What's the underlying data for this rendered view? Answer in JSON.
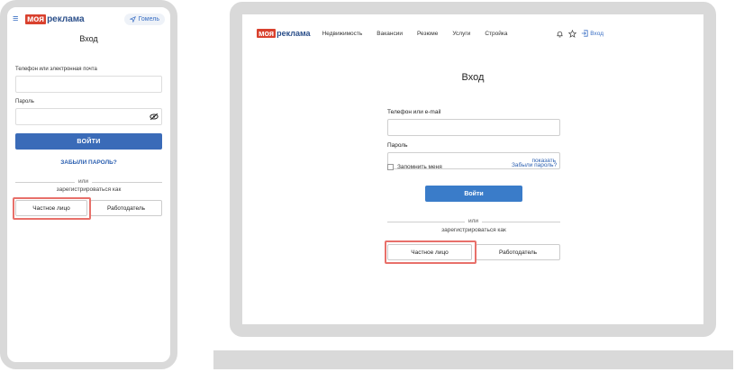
{
  "brand": {
    "box": "моя",
    "rest": "реклама"
  },
  "colors": {
    "accent": "#3a6bb8",
    "brand_red": "#d9412e",
    "highlight": "#e8706a"
  },
  "mobile": {
    "menu_icon": "hamburger-icon",
    "city_label": "Гомель",
    "title": "Вход",
    "phone_label": "Телефон или электронная почта",
    "password_label": "Пароль",
    "login_button": "ВОЙТИ",
    "forgot_link": "ЗАБЫЛИ ПАРОЛЬ?",
    "or_text": "или",
    "register_as": "зарегистрироваться как",
    "option_private": "Частное лицо",
    "option_employer": "Работодатель"
  },
  "desktop": {
    "nav": [
      "Недвижимость",
      "Вакансии",
      "Резюме",
      "Услуги",
      "Стройка"
    ],
    "login_link": "Вход",
    "title": "Вход",
    "phone_label": "Телефон или e-mail",
    "password_label": "Пароль",
    "show_link": "показать",
    "remember_label": "Запомнить меня",
    "forgot_link": "Забыли пароль?",
    "login_button": "Войти",
    "or_text": "или",
    "register_as": "зарегистрироваться как",
    "option_private": "Частное лицо",
    "option_employer": "Работодатель"
  }
}
